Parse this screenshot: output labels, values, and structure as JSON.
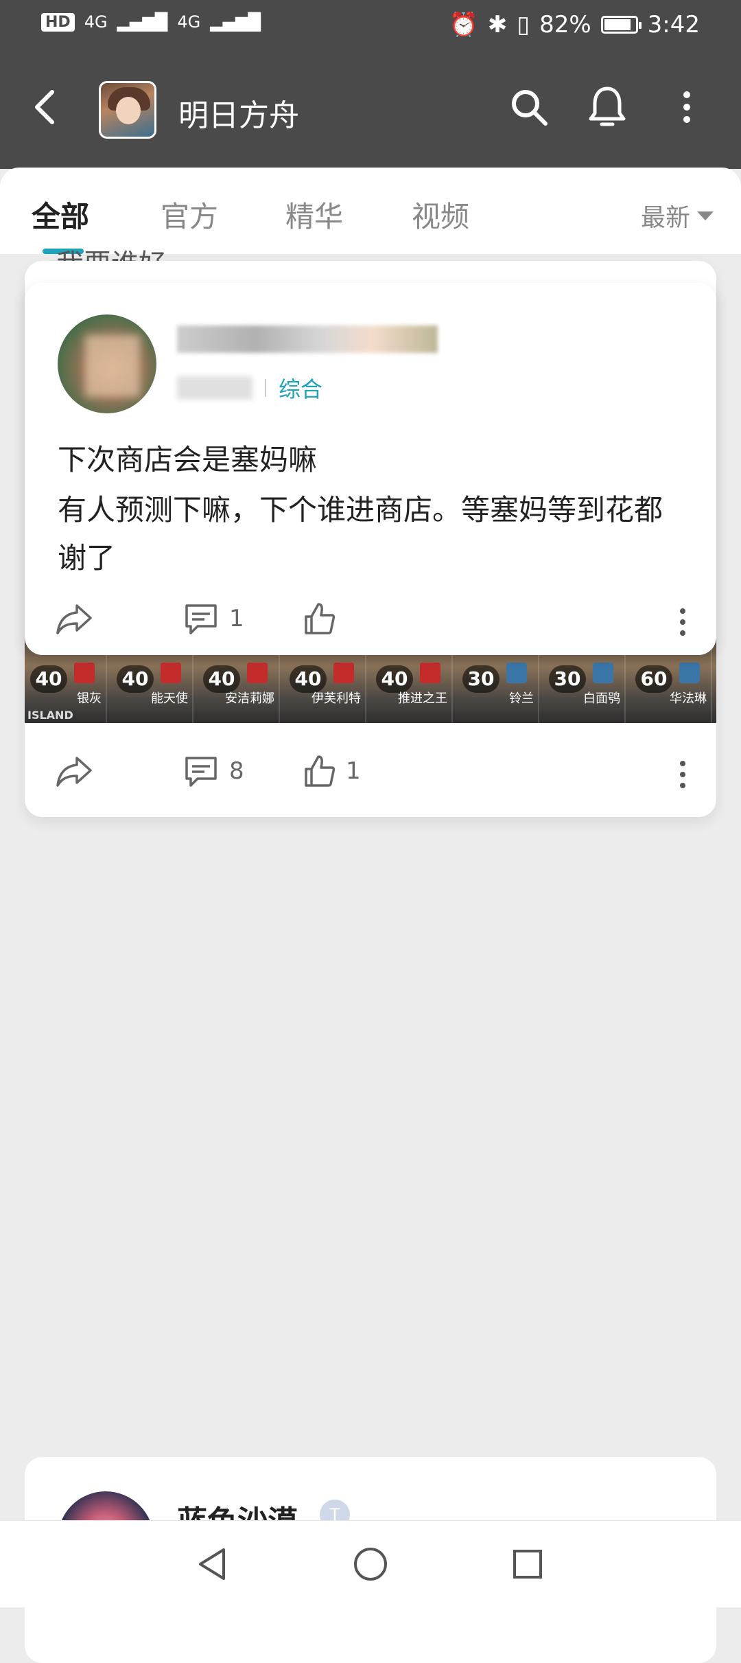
{
  "status_bar": {
    "signal_label": "4G",
    "battery_percent": "82%",
    "time": "3:42"
  },
  "app_bar": {
    "title": "明日方舟"
  },
  "tabs": [
    {
      "label": "全部",
      "active": true
    },
    {
      "label": "官方",
      "active": false
    },
    {
      "label": "精华",
      "active": false
    },
    {
      "label": "视频",
      "active": false
    }
  ],
  "sort": {
    "label": "最新"
  },
  "partial_text": "我要谁好",
  "post": {
    "tag": "综合",
    "title": "下次商店会是塞妈嘛",
    "body": "有人预测下嘛，下个谁进商店。等塞妈等到花都谢了",
    "comment_count": "1",
    "like_count": ""
  },
  "back_post": {
    "comment_count": "8",
    "like_count": "1",
    "operators": [
      {
        "level": "40",
        "name": "银灰"
      },
      {
        "level": "40",
        "name": "能天使"
      },
      {
        "level": "40",
        "name": "安洁莉娜"
      },
      {
        "level": "40",
        "name": "伊芙利特"
      },
      {
        "level": "40",
        "name": "推进之王"
      },
      {
        "level": "30",
        "name": "铃兰"
      },
      {
        "level": "30",
        "name": "白面鸮"
      },
      {
        "level": "60",
        "name": "华法琳"
      }
    ],
    "strip_label": "ISLAND"
  },
  "next_post": {
    "author": "蓝色沙漠",
    "badge": "T"
  }
}
